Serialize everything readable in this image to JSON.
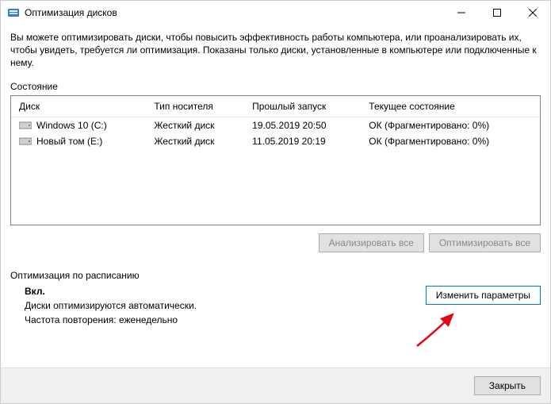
{
  "window": {
    "title": "Оптимизация дисков"
  },
  "description": "Вы можете оптимизировать диски, чтобы повысить эффективность работы  компьютера, или проанализировать их, чтобы увидеть, требуется ли оптимизация. Показаны только диски, установленные в компьютере или подключенные к нему.",
  "status_label": "Состояние",
  "columns": {
    "disk": "Диск",
    "media": "Тип носителя",
    "last": "Прошлый запуск",
    "state": "Текущее состояние"
  },
  "drives": [
    {
      "name": "Windows 10 (C:)",
      "media": "Жесткий диск",
      "last": "19.05.2019 20:50",
      "state": "ОК (Фрагментировано: 0%)"
    },
    {
      "name": "Новый том (E:)",
      "media": "Жесткий диск",
      "last": "11.05.2019 20:19",
      "state": "ОК (Фрагментировано: 0%)"
    }
  ],
  "buttons": {
    "analyze_all": "Анализировать все",
    "optimize_all": "Оптимизировать все",
    "change": "Изменить параметры",
    "close": "Закрыть"
  },
  "schedule": {
    "header": "Оптимизация по расписанию",
    "status": "Вкл.",
    "line1": "Диски оптимизируются автоматически.",
    "line2": "Частота повторения: еженедельно"
  }
}
